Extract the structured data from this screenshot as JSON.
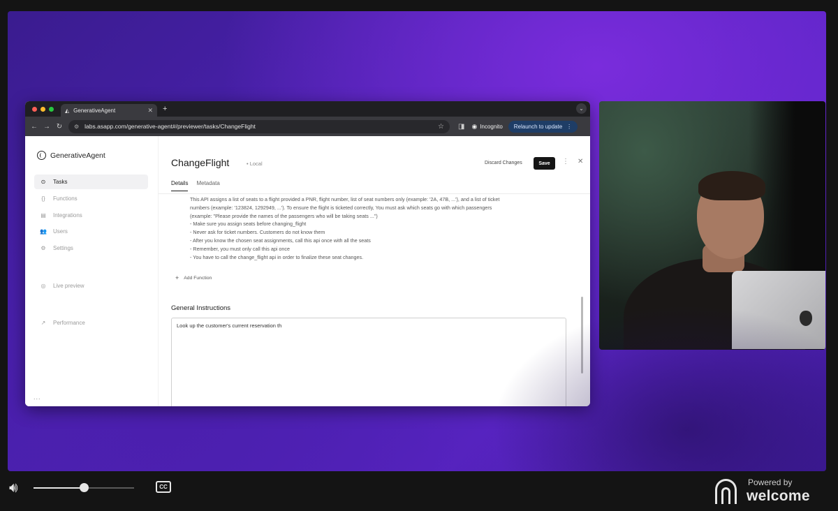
{
  "browser": {
    "tab_title": "GenerativeAgent",
    "url": "labs.asapp.com/generative-agent#/previewer/tasks/ChangeFlight",
    "incognito_label": "Incognito",
    "relaunch_label": "Relaunch to update",
    "traffic_colors": [
      "#ff5f57",
      "#febc2e",
      "#28c840"
    ]
  },
  "app": {
    "logo_text": "GenerativeAgent",
    "sidebar": {
      "items": [
        {
          "label": "Tasks",
          "icon": "tasks-icon"
        },
        {
          "label": "Functions",
          "icon": "braces-icon"
        },
        {
          "label": "Integrations",
          "icon": "integrations-icon"
        },
        {
          "label": "Users",
          "icon": "users-icon"
        },
        {
          "label": "Settings",
          "icon": "gear-icon"
        },
        {
          "label": "Live preview",
          "icon": "eye-icon"
        },
        {
          "label": "Performance",
          "icon": "trend-icon"
        }
      ],
      "more": "..."
    },
    "task": {
      "title": "ChangeFlight",
      "badge": "• Local",
      "discard_label": "Discard Changes",
      "save_label": "Save",
      "tabs": [
        "Details",
        "Metadata"
      ],
      "description_lines": [
        "This API assigns a list of seats to a flight provided a PNR, flight number, list of seat numbers only (example: '2A, 47B, ...'), and a list of ticket",
        "numbers (example: '123824, 1292949, ...'). To ensure the flight is ticketed correctly, You must ask which seats go with which passengers",
        "(example: \"Please provide the names of the passengers who will be taking seats ...\")",
        "- Make sure you assign seats before changing_flight",
        "- Never ask for ticket numbers. Customers do not know them",
        "- After you know the chosen seat assignments, call this api once with all the seats",
        "- Remember, you must only call this api once",
        "- You have to call the change_flight api in order to finalize these seat changes."
      ],
      "add_function_label": "Add Function",
      "general_instructions_title": "General Instructions",
      "general_instructions_value": "Look up the customer's current reservation th"
    }
  },
  "player": {
    "volume": 0.5,
    "cc_label": "CC",
    "powered_by": "Powered by",
    "brand": "welcome"
  }
}
